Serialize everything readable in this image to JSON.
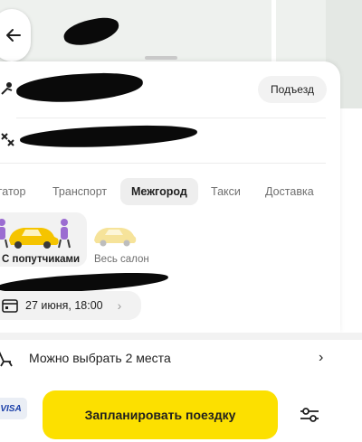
{
  "address": {
    "entrance_label": "Подъезд"
  },
  "tabs": [
    {
      "label": "гатор",
      "active": false
    },
    {
      "label": "Транспорт",
      "active": false
    },
    {
      "label": "Межгород",
      "active": true
    },
    {
      "label": "Такси",
      "active": false
    },
    {
      "label": "Доставка",
      "active": false
    }
  ],
  "tariffs": [
    {
      "label": "С попутчиками",
      "selected": true
    },
    {
      "label": "Весь салон",
      "selected": false
    }
  ],
  "date_time": "27 июня, 18:00",
  "seats_text": "Можно выбрать 2 места",
  "payment": {
    "card_label": "VISA"
  },
  "order_button_label": "Запланировать поездку",
  "colors": {
    "accent": "#fce000",
    "car_yellow": "#f5c400",
    "car_pale": "#f6e39a",
    "passenger": "#9b6cd1"
  },
  "icons": [
    "back-arrow-icon",
    "person-location-icon",
    "finish-flag-icon",
    "calendar-icon",
    "chevron-right-icon",
    "seat-icon",
    "settings-sliders-icon"
  ]
}
